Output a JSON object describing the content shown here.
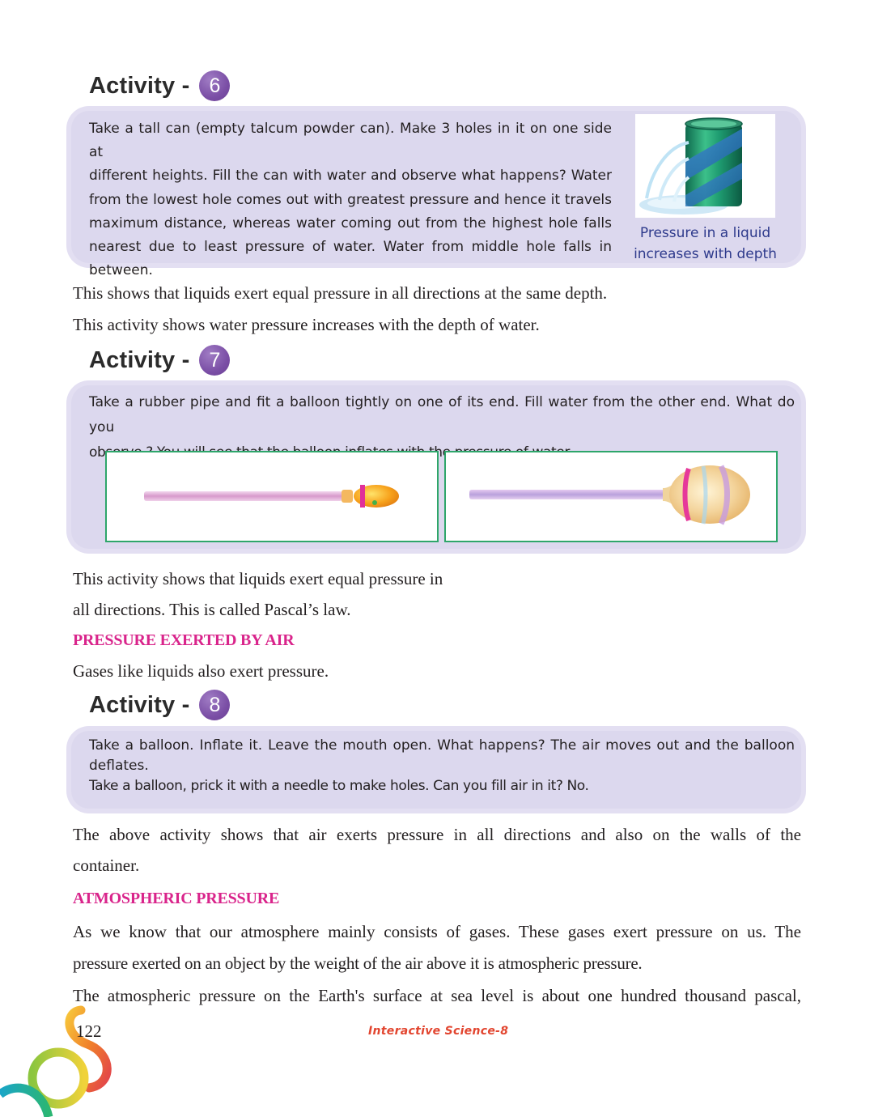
{
  "activity6": {
    "label": "Activity -",
    "number": "6",
    "lines": [
      "Take a tall can (empty talcum powder can). Make 3 holes in it on one side at",
      "different heights. Fill the can with water and observe what happens? Water",
      "from the lowest hole comes out with greatest pressure and hence it travels",
      "maximum distance, whereas water coming out from the highest hole falls",
      "nearest due to least pressure of water. Water from middle hole falls in",
      "between."
    ],
    "caption_line1": "Pressure in a liquid",
    "caption_line2": "increases with depth"
  },
  "after6": {
    "line1": "This shows that liquids exert equal pressure in all directions at the same depth.",
    "line2": "This activity shows water pressure increases with the depth of water."
  },
  "activity7": {
    "label": "Activity -",
    "number": "7",
    "line1": "Take a rubber pipe and fit a balloon tightly on one of its end. Fill water from the other end. What do you",
    "line2": "observe.? You will see that the balloon inflates with the pressure of water."
  },
  "after7": {
    "line1": "This activity shows that liquids exert equal pressure in",
    "line2": "all directions. This is called Pascal’s law."
  },
  "air_section": {
    "heading": "PRESSURE EXERTED BY AIR",
    "text": "Gases like liquids also exert pressure."
  },
  "activity8": {
    "label": "Activity -",
    "number": "8",
    "line1": "Take a balloon. Inflate it. Leave the mouth open. What happens? The air moves out and the balloon",
    "line2": "deflates.",
    "line3": "Take a balloon, prick it with a needle to make holes. Can you fill air in it? No."
  },
  "after8": {
    "line1": "The above activity shows that air exerts pressure in all directions and also on the walls of the",
    "line2": "container."
  },
  "atmos_section": {
    "heading": "ATMOSPHERIC PRESSURE",
    "line1": "As we know that our atmosphere mainly consists of gases. These gases exert pressure on us. The",
    "line2": "pressure exerted on an object by the weight of the air above it is atmospheric pressure.",
    "line3": "The atmospheric pressure on the Earth's surface at sea level is about one hundred thousand pascal,"
  },
  "footer": {
    "page_number": "122",
    "book_title": "Interactive Science-8"
  }
}
